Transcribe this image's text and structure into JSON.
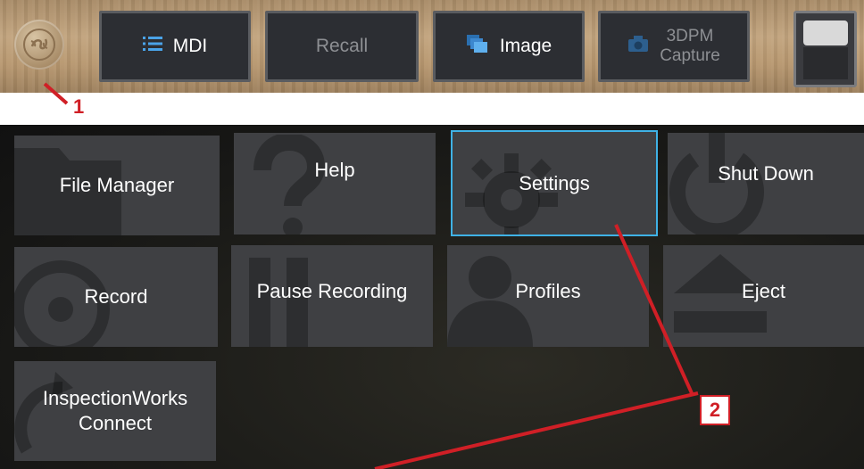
{
  "toolbar": {
    "logo_icon": "ge-logo-icon",
    "buttons": [
      {
        "label": "MDI",
        "icon": "list-icon"
      },
      {
        "label": "Recall"
      },
      {
        "label": "Image",
        "icon": "images-icon"
      },
      {
        "label_line1": "3DPM",
        "label_line2": "Capture",
        "icon": "camera-icon"
      }
    ]
  },
  "annotations": {
    "callout_1": "1",
    "callout_2": "2",
    "color": "#d01f26"
  },
  "menu": {
    "tiles": [
      {
        "label": "File Manager",
        "icon": "folder-icon"
      },
      {
        "label": "Help",
        "icon": "question-icon"
      },
      {
        "label": "Settings",
        "icon": "gear-icon",
        "selected": true
      },
      {
        "label": "Shut Down",
        "icon": "power-icon"
      },
      {
        "label": "Record",
        "icon": "record-icon"
      },
      {
        "label": "Pause Recording",
        "icon": "pause-icon"
      },
      {
        "label": "Profiles",
        "icon": "person-icon"
      },
      {
        "label": "Eject",
        "icon": "eject-icon"
      },
      {
        "label_line1": "InspectionWorks",
        "label_line2": "Connect",
        "icon": "sync-icon"
      }
    ]
  },
  "colors": {
    "selected_border": "#3fb2e6",
    "tile_bg": "#3f4043"
  }
}
